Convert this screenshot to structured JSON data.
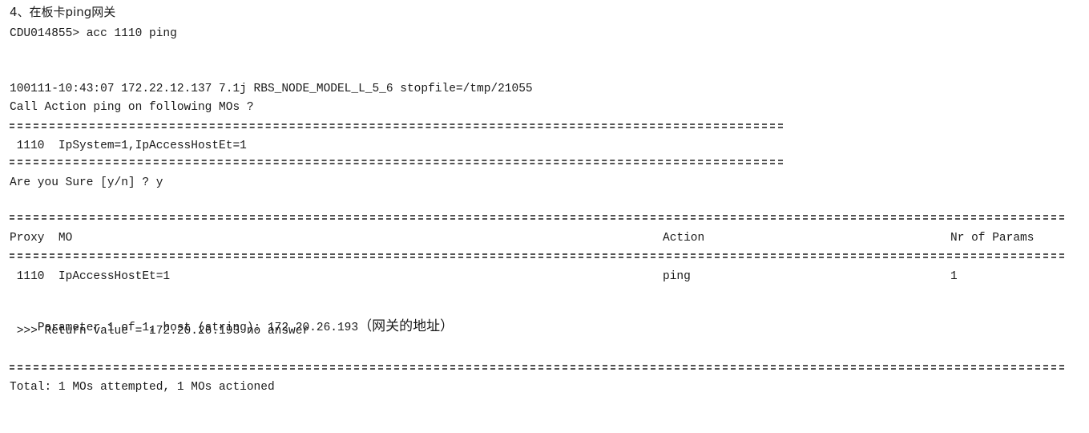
{
  "terminal": {
    "step_label": "4、在板卡ping网关",
    "prompt_cmd": "CDU014855> acc 1110 ping",
    "status_line": "100111-10:43:07 172.22.12.137 7.1j RBS_NODE_MODEL_L_5_6 stopfile=/tmp/21055",
    "question": "Call Action ping on following MOs ?",
    "mo_entry": " 1110  IpSystem=1,IpAccessHostEt=1",
    "confirm": "Are you Sure [y/n] ? y",
    "table": {
      "headers": {
        "proxy_mo": "Proxy  MO",
        "action": "Action",
        "params": "Nr of Params"
      },
      "row": {
        "proxy_mo": " 1110  IpAccessHostEt=1",
        "action": "ping",
        "params": "1"
      }
    },
    "param_prompt": "Parameter 1 of 1, host (string): 172.20.26.193",
    "param_note": "（网关的地址）",
    "return_value": " >>> Return value = 172.20.26.193 no answer",
    "total": "Total: 1 MOs attempted, 1 MOs actioned"
  }
}
